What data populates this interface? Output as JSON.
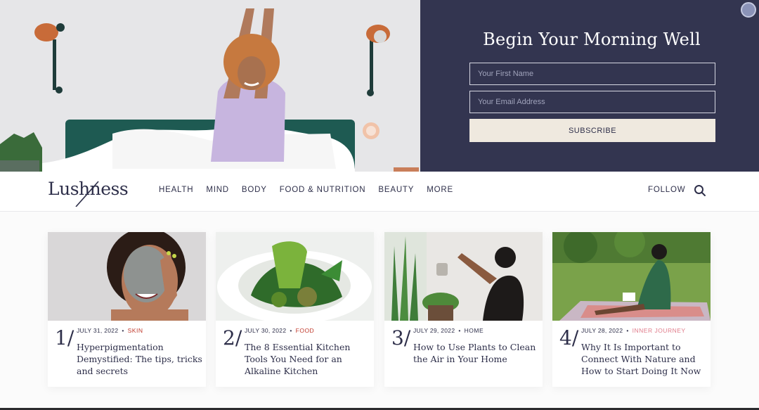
{
  "hero": {
    "title": "Begin Your Morning Well",
    "first_name_placeholder": "Your First Name",
    "email_placeholder": "Your Email Address",
    "subscribe_label": "SUBSCRIBE",
    "panel_color": "#333550"
  },
  "nav": {
    "logo": "Lushness",
    "items": [
      "HEALTH",
      "MIND",
      "BODY",
      "FOOD & NUTRITION",
      "BEAUTY",
      "MORE"
    ],
    "follow_label": "FOLLOW",
    "search_icon": "search-icon"
  },
  "articles": [
    {
      "number": "1/",
      "date": "JULY 31, 2022",
      "category": "SKIN",
      "category_color": "#c0392b",
      "title": "Hyperpigmentation Demystified: The tips, tricks and secrets"
    },
    {
      "number": "2/",
      "date": "JULY 30, 2022",
      "category": "FOOD",
      "category_color": "#c0392b",
      "title": "The 8 Essential Kitchen Tools You Need for an Alkaline Kitchen"
    },
    {
      "number": "3/",
      "date": "JULY 29, 2022",
      "category": "HOME",
      "category_color": "#2e2f4a",
      "title": "How to Use Plants to Clean the Air in Your Home"
    },
    {
      "number": "4/",
      "date": "JULY 28, 2022",
      "category": "INNER JOURNEY",
      "category_color": "#e07b8a",
      "title": "Why It Is Important to Connect With Nature and How to Start Doing It Now"
    }
  ]
}
